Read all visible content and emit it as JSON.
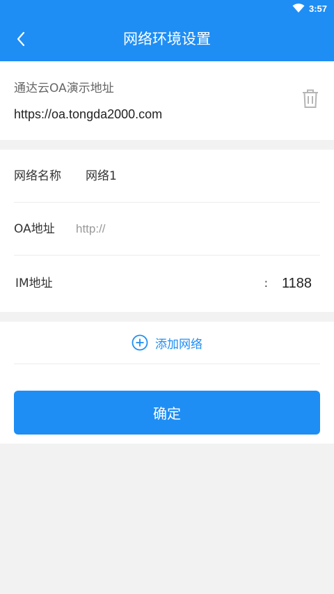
{
  "status": {
    "time": "3:57"
  },
  "header": {
    "title": "网络环境设置"
  },
  "saved_network": {
    "name": "通达云OA演示地址",
    "url": "https://oa.tongda2000.com"
  },
  "form": {
    "network_name_label": "网络名称",
    "network_name_value": "网络1",
    "oa_address_label": "OA地址",
    "oa_address_placeholder": "http://",
    "im_address_label": "IM地址",
    "im_colon": ":",
    "im_port": "1188"
  },
  "actions": {
    "add_network_label": "添加网络",
    "confirm_label": "确定"
  },
  "colors": {
    "primary": "#1e8ef5",
    "background": "#f2f2f2"
  },
  "icons": {
    "back": "chevron-left-icon",
    "wifi": "wifi-icon",
    "delete": "trash-icon",
    "add": "plus-circle-icon"
  }
}
